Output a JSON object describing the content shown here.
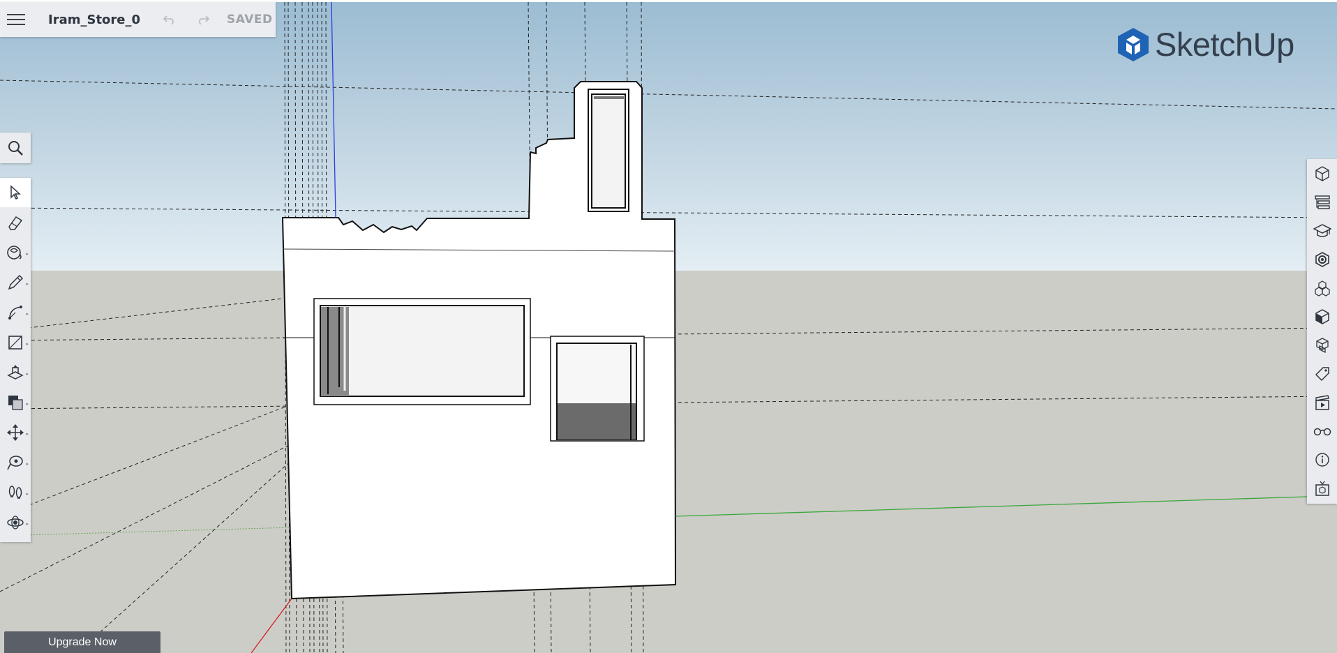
{
  "app": {
    "document_title": "Iram_Store_0",
    "save_status": "SAVED",
    "logo_text": "SketchUp",
    "brand_color": "#1f63b5"
  },
  "toolbar_top": {
    "menu_icon": "hamburger-icon",
    "undo_icon": "undo-icon",
    "redo_icon": "redo-icon"
  },
  "left_tools": [
    {
      "name": "search",
      "icon": "search-icon"
    },
    {
      "name": "select",
      "icon": "select-arrow-icon",
      "selected": true
    },
    {
      "name": "eraser",
      "icon": "eraser-icon"
    },
    {
      "name": "paint",
      "icon": "paint-bucket-icon"
    },
    {
      "name": "pencil",
      "icon": "pencil-icon"
    },
    {
      "name": "arc",
      "icon": "arc-icon"
    },
    {
      "name": "rectangle",
      "icon": "rectangle-icon"
    },
    {
      "name": "push-pull",
      "icon": "push-pull-icon"
    },
    {
      "name": "offset",
      "icon": "offset-icon"
    },
    {
      "name": "move",
      "icon": "move-icon"
    },
    {
      "name": "tape-measure",
      "icon": "tape-measure-icon"
    },
    {
      "name": "walk",
      "icon": "footprints-icon"
    },
    {
      "name": "orbit",
      "icon": "orbit-icon"
    }
  ],
  "right_panels": [
    {
      "name": "entity-info",
      "icon": "cube-outline-icon"
    },
    {
      "name": "outliner",
      "icon": "outliner-icon"
    },
    {
      "name": "instructor",
      "icon": "graduation-cap-icon"
    },
    {
      "name": "materials",
      "icon": "materials-icon"
    },
    {
      "name": "components",
      "icon": "components-icon"
    },
    {
      "name": "styles",
      "icon": "styles-cube-icon"
    },
    {
      "name": "solid-tools",
      "icon": "solid-tools-icon"
    },
    {
      "name": "tags",
      "icon": "tag-icon"
    },
    {
      "name": "scenes",
      "icon": "clapperboard-icon"
    },
    {
      "name": "display",
      "icon": "glasses-icon"
    },
    {
      "name": "model-info",
      "icon": "info-icon"
    },
    {
      "name": "extensions",
      "icon": "extension-box-icon"
    }
  ],
  "upgrade": {
    "label": "Upgrade Now"
  }
}
